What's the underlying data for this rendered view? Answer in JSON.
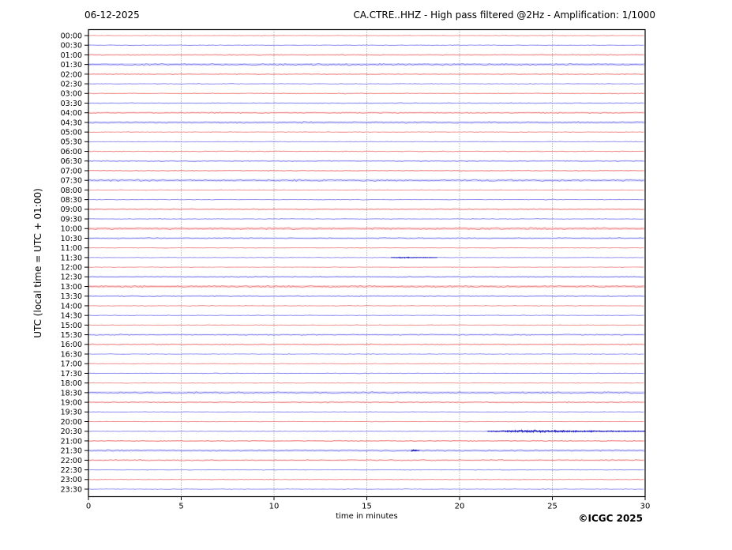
{
  "header": {
    "date": "06-12-2025",
    "title": "CA.CTRE..HHZ - High pass filtered @2Hz - Amplification: 1/1000"
  },
  "footer": {
    "copyright": "©ICGC 2025"
  },
  "chart_data": {
    "type": "line",
    "subtype": "helicorder-dayplot",
    "title": "CA.CTRE..HHZ - High pass filtered @2Hz - Amplification: 1/1000",
    "date": "06-12-2025",
    "xlabel": "time in minutes",
    "ylabel": "UTC (local time = UTC + 01:00)",
    "xlim": [
      0,
      30
    ],
    "x_ticks": [
      0,
      5,
      10,
      15,
      20,
      25,
      30
    ],
    "grid_minutes": [
      5,
      10,
      15,
      20,
      25
    ],
    "grid_on": true,
    "minutes_per_row": 30,
    "trace_colors": {
      "r": "#ee7878",
      "b": "#7878ee"
    },
    "event_color": "#1e1ec0",
    "grid_color": "#888888",
    "axis_color": "#000000",
    "rows": [
      {
        "t": "00:00",
        "c": "r",
        "n": 0.5
      },
      {
        "t": "00:30",
        "c": "b",
        "n": 0.5
      },
      {
        "t": "01:00",
        "c": "r",
        "n": 0.9
      },
      {
        "t": "01:30",
        "c": "b",
        "n": 1.4
      },
      {
        "t": "02:00",
        "c": "r",
        "n": 0.9
      },
      {
        "t": "02:30",
        "c": "b",
        "n": 0.5
      },
      {
        "t": "03:00",
        "c": "r",
        "n": 0.7
      },
      {
        "t": "03:30",
        "c": "b",
        "n": 0.7
      },
      {
        "t": "04:00",
        "c": "r",
        "n": 1.0
      },
      {
        "t": "04:30",
        "c": "b",
        "n": 1.4
      },
      {
        "t": "05:00",
        "c": "r",
        "n": 0.5
      },
      {
        "t": "05:30",
        "c": "b",
        "n": 0.5
      },
      {
        "t": "06:00",
        "c": "r",
        "n": 0.6
      },
      {
        "t": "06:30",
        "c": "b",
        "n": 0.9
      },
      {
        "t": "07:00",
        "c": "r",
        "n": 0.9
      },
      {
        "t": "07:30",
        "c": "b",
        "n": 1.4
      },
      {
        "t": "08:00",
        "c": "r",
        "n": 0.4
      },
      {
        "t": "08:30",
        "c": "b",
        "n": 0.5
      },
      {
        "t": "09:00",
        "c": "r",
        "n": 1.0
      },
      {
        "t": "09:30",
        "c": "b",
        "n": 0.6
      },
      {
        "t": "10:00",
        "c": "r",
        "n": 1.5
      },
      {
        "t": "10:30",
        "c": "b",
        "n": 1.0
      },
      {
        "t": "11:00",
        "c": "r",
        "n": 0.5
      },
      {
        "t": "11:30",
        "c": "b",
        "n": 0.5
      },
      {
        "t": "12:00",
        "c": "r",
        "n": 0.4
      },
      {
        "t": "12:30",
        "c": "b",
        "n": 1.0
      },
      {
        "t": "13:00",
        "c": "r",
        "n": 1.5
      },
      {
        "t": "13:30",
        "c": "b",
        "n": 1.0
      },
      {
        "t": "14:00",
        "c": "r",
        "n": 0.5
      },
      {
        "t": "14:30",
        "c": "b",
        "n": 0.6
      },
      {
        "t": "15:00",
        "c": "r",
        "n": 0.5
      },
      {
        "t": "15:30",
        "c": "b",
        "n": 0.9
      },
      {
        "t": "16:00",
        "c": "r",
        "n": 0.9
      },
      {
        "t": "16:30",
        "c": "b",
        "n": 0.5
      },
      {
        "t": "17:00",
        "c": "r",
        "n": 0.5
      },
      {
        "t": "17:30",
        "c": "b",
        "n": 0.5
      },
      {
        "t": "18:00",
        "c": "r",
        "n": 0.4
      },
      {
        "t": "18:30",
        "c": "b",
        "n": 1.4
      },
      {
        "t": "19:00",
        "c": "r",
        "n": 1.0
      },
      {
        "t": "19:30",
        "c": "b",
        "n": 0.5
      },
      {
        "t": "20:00",
        "c": "r",
        "n": 0.5
      },
      {
        "t": "20:30",
        "c": "b",
        "n": 0.5
      },
      {
        "t": "21:00",
        "c": "r",
        "n": 0.9
      },
      {
        "t": "21:30",
        "c": "b",
        "n": 1.3
      },
      {
        "t": "22:00",
        "c": "r",
        "n": 1.0
      },
      {
        "t": "22:30",
        "c": "b",
        "n": 0.5
      },
      {
        "t": "23:00",
        "c": "r",
        "n": 0.6
      },
      {
        "t": "23:30",
        "c": "b",
        "n": 0.5
      }
    ],
    "events": [
      {
        "row": "11:30",
        "start_min": 16.3,
        "peak_min": 17.0,
        "end_min": 18.8,
        "amp": 0.7
      },
      {
        "row": "20:30",
        "start_min": 21.5,
        "peak_min": 23.6,
        "end_min": 30.0,
        "amp": 1.7
      },
      {
        "row": "21:30",
        "start_min": 17.4,
        "peak_min": 17.55,
        "end_min": 17.85,
        "amp": 1.3
      }
    ]
  }
}
